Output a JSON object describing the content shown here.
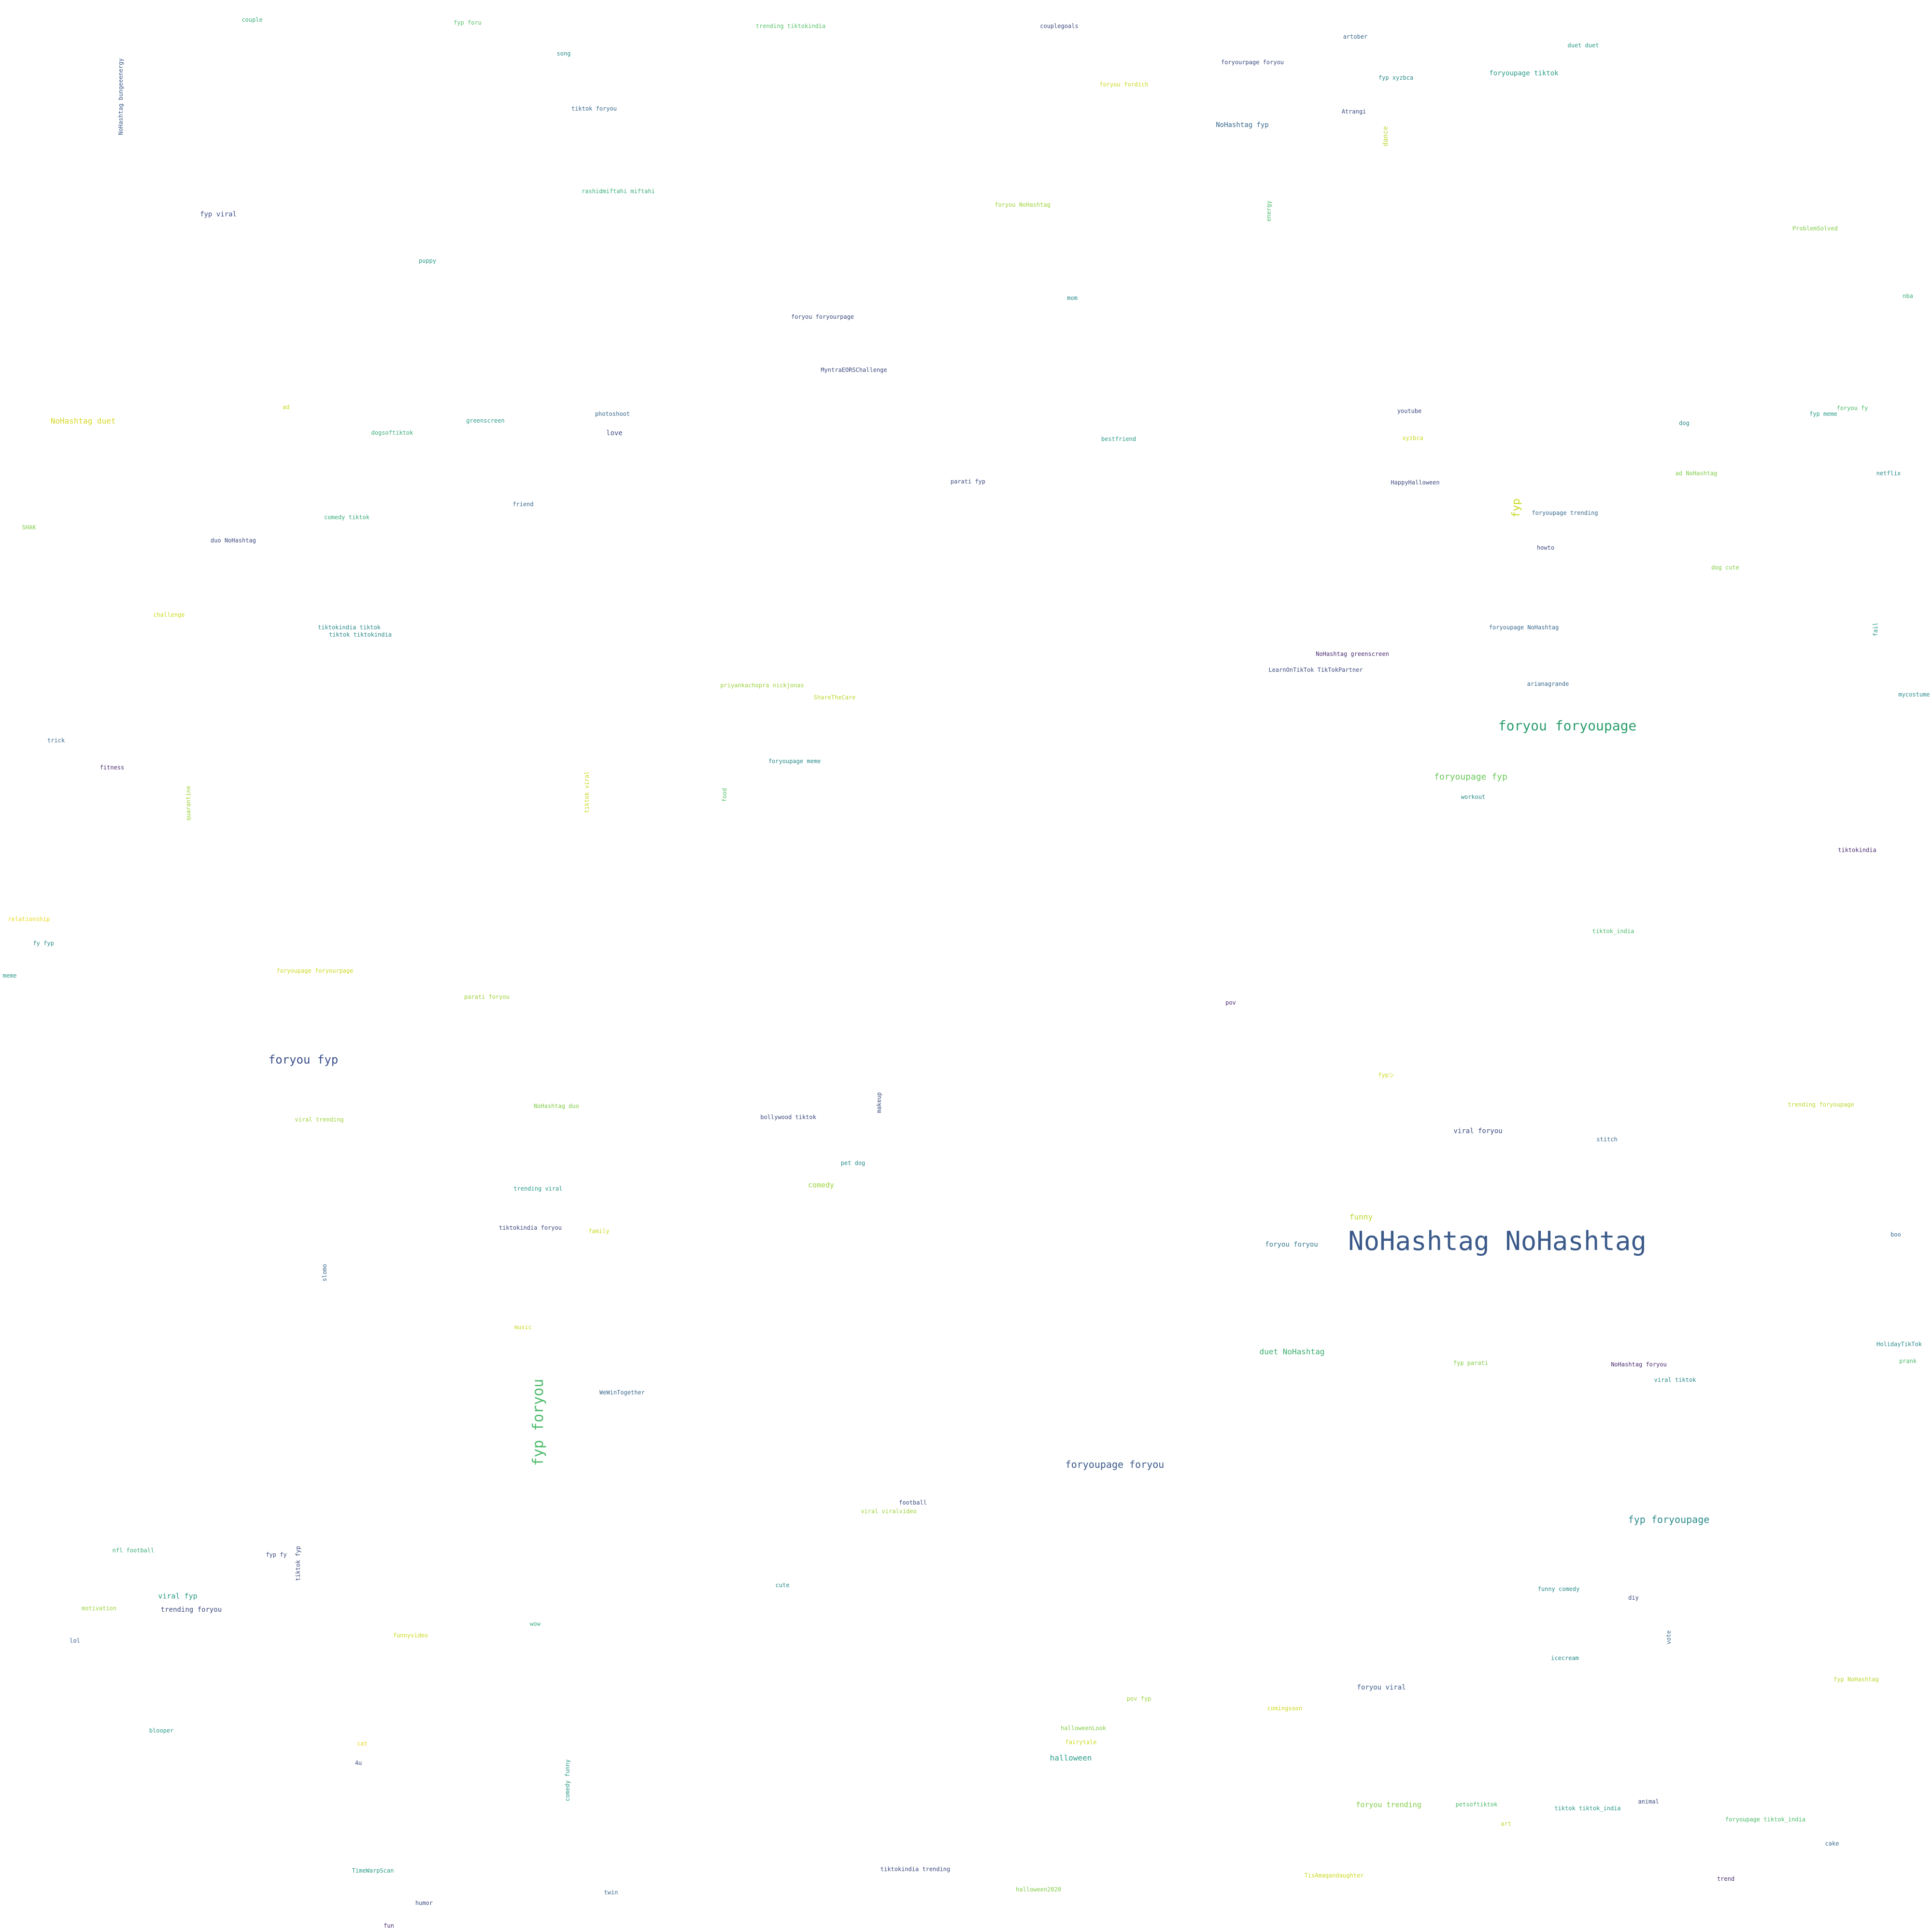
{
  "words": [
    {
      "text": "NoHashtag NoHashtag",
      "color": "#3b5a8a"
    },
    {
      "text": "foryou foryoupage",
      "color": "#2a9d6e"
    },
    {
      "text": "fyp foryou",
      "color": "#4cba6a"
    },
    {
      "text": "foryou fyp",
      "color": "#3b4f8a"
    },
    {
      "text": "foryoupage foryou",
      "color": "#3b5a8a"
    },
    {
      "text": "fyp foryoupage",
      "color": "#2b8a8a"
    },
    {
      "text": "duet NoHashtag",
      "color": "#3aad6e"
    },
    {
      "text": "foryoupage fyp",
      "color": "#6ac85a"
    },
    {
      "text": "NoHashtag duet",
      "color": "#d8d828"
    },
    {
      "text": "fyp",
      "color": "#cad820"
    },
    {
      "text": "funny",
      "color": "#b8d830"
    },
    {
      "text": "halloween",
      "color": "#2b9c8a"
    },
    {
      "text": "foryou trending",
      "color": "#82cc48"
    },
    {
      "text": "viral foryou",
      "color": "#3b4a7e"
    },
    {
      "text": "comedy",
      "color": "#9cd23a"
    },
    {
      "text": "viral fyp",
      "color": "#2b9a82"
    },
    {
      "text": "trending foryou",
      "color": "#3b4a7e"
    },
    {
      "text": "foryou viral",
      "color": "#3b5a8a"
    },
    {
      "text": "foryou foryou",
      "color": "#3a7a8e"
    },
    {
      "text": "fyp viral",
      "color": "#3b4f8a"
    },
    {
      "text": "NoHashtag fyp",
      "color": "#3a6a8e"
    },
    {
      "text": "foryoupage tiktok",
      "color": "#2b9a88"
    },
    {
      "text": "love",
      "color": "#3b4a7e"
    },
    {
      "text": "couple",
      "color": "#3aad7a"
    },
    {
      "text": "fyp foru",
      "color": "#5ac26a"
    },
    {
      "text": "trending tiktokindia",
      "color": "#5ac26a"
    },
    {
      "text": "couplegoals",
      "color": "#3b4a7e"
    },
    {
      "text": "artober",
      "color": "#3a6a8e"
    },
    {
      "text": "duet duet",
      "color": "#2b9a88"
    },
    {
      "text": "foryourpage foryou",
      "color": "#3b4a7e"
    },
    {
      "text": "fyp xyzbca",
      "color": "#2b8a8a"
    },
    {
      "text": "foryou fordich",
      "color": "#cad820"
    },
    {
      "text": "song",
      "color": "#2b8a8a"
    },
    {
      "text": "tiktok foryou",
      "color": "#3a6a8e"
    },
    {
      "text": "Atrangi",
      "color": "#3b4a7e"
    },
    {
      "text": "dance",
      "color": "#b8d830"
    },
    {
      "text": "NoHashtag bungeeenergy",
      "color": "#3b5a8a"
    },
    {
      "text": "rashidmiftahi miftahi",
      "color": "#3aad7a"
    },
    {
      "text": "foryou NoHashtag",
      "color": "#9cd23a"
    },
    {
      "text": "energy",
      "color": "#4cba6a"
    },
    {
      "text": "ProblemSolved",
      "color": "#82cc48"
    },
    {
      "text": "puppy",
      "color": "#2b9a88"
    },
    {
      "text": "mom",
      "color": "#2b8a8a"
    },
    {
      "text": "nba",
      "color": "#3aad7a"
    },
    {
      "text": "foryou foryourpage",
      "color": "#3b4a7e"
    },
    {
      "text": "MyntraEORSChallenge",
      "color": "#3b4a7e"
    },
    {
      "text": "ad",
      "color": "#cad820"
    },
    {
      "text": "greenscreen",
      "color": "#2b9a88"
    },
    {
      "text": "photoshoot",
      "color": "#3a6a8e"
    },
    {
      "text": "dogsoftiktok",
      "color": "#3aad7a"
    },
    {
      "text": "youtube",
      "color": "#3b4a7e"
    },
    {
      "text": "dog",
      "color": "#2b8a8a"
    },
    {
      "text": "fyp meme",
      "color": "#2b9a88"
    },
    {
      "text": "foryou fy",
      "color": "#4cba6a"
    },
    {
      "text": "bestfriend",
      "color": "#2b9a88"
    },
    {
      "text": "xyzbca",
      "color": "#cad820"
    },
    {
      "text": "ad NoHashtag",
      "color": "#82cc48"
    },
    {
      "text": "netflix",
      "color": "#2b8a8a"
    },
    {
      "text": "parati fyp",
      "color": "#3b4a7e"
    },
    {
      "text": "HappyHalloween",
      "color": "#3b4a7e"
    },
    {
      "text": "foryoupage trending",
      "color": "#3a6a8e"
    },
    {
      "text": "friend",
      "color": "#3a6a8e"
    },
    {
      "text": "comedy tiktok",
      "color": "#3aad7a"
    },
    {
      "text": "SHAK",
      "color": "#82cc48"
    },
    {
      "text": "duo NoHashtag",
      "color": "#3b4a7e"
    },
    {
      "text": "howto",
      "color": "#3b4a7e"
    },
    {
      "text": "dog cute",
      "color": "#82cc48"
    },
    {
      "text": "challenge",
      "color": "#cad820"
    },
    {
      "text": "tiktokindia tiktok",
      "color": "#2b8a8a"
    },
    {
      "text": "tiktok tiktokindia",
      "color": "#2b8a8a"
    },
    {
      "text": "foryoupage NoHashtag",
      "color": "#3a6a8e"
    },
    {
      "text": "fail",
      "color": "#2b9a88"
    },
    {
      "text": "NoHashtag greenscreen",
      "color": "#4a2a6e"
    },
    {
      "text": "LearnOnTikTok TikTokPartner",
      "color": "#3b4a7e"
    },
    {
      "text": "arianagrande",
      "color": "#3a6a8e"
    },
    {
      "text": "mycostume",
      "color": "#2b8a8a"
    },
    {
      "text": "priyankachopra nickjonas",
      "color": "#9cd23a"
    },
    {
      "text": "ShareTheCare",
      "color": "#b8d830"
    },
    {
      "text": "trick",
      "color": "#3a6a8e"
    },
    {
      "text": "fitness",
      "color": "#4a2a6e"
    },
    {
      "text": "quarantine",
      "color": "#9cd23a"
    },
    {
      "text": "tiktok viral",
      "color": "#cad820"
    },
    {
      "text": "foryoupage meme",
      "color": "#2b8a8a"
    },
    {
      "text": "food",
      "color": "#5ac26a"
    },
    {
      "text": "workout",
      "color": "#2b8a8a"
    },
    {
      "text": "tiktokindia",
      "color": "#4a2a6e"
    },
    {
      "text": "relationship",
      "color": "#e8d820"
    },
    {
      "text": "fy fyp",
      "color": "#2b8a8a"
    },
    {
      "text": "meme",
      "color": "#2b9a88"
    },
    {
      "text": "foryoupage foryourpage",
      "color": "#cad820"
    },
    {
      "text": "parati foryou",
      "color": "#9cd23a"
    },
    {
      "text": "tiktok_india",
      "color": "#4cba6a"
    },
    {
      "text": "pov",
      "color": "#4a2a6e"
    },
    {
      "text": "fypシ",
      "color": "#cad820"
    },
    {
      "text": "trending foryoupage",
      "color": "#b8d830"
    },
    {
      "text": "viral trending",
      "color": "#9cd23a"
    },
    {
      "text": "NoHashtag duo",
      "color": "#82cc48"
    },
    {
      "text": "bollywood tiktok",
      "color": "#3b4a7e"
    },
    {
      "text": "makeup",
      "color": "#3b4a7e"
    },
    {
      "text": "stitch",
      "color": "#3a6a8e"
    },
    {
      "text": "pet dog",
      "color": "#2b8a8a"
    },
    {
      "text": "trending viral",
      "color": "#2b9a88"
    },
    {
      "text": "tiktokindia foryou",
      "color": "#3b4a7e"
    },
    {
      "text": "family",
      "color": "#cad820"
    },
    {
      "text": "boo",
      "color": "#3a6a8e"
    },
    {
      "text": "slomo",
      "color": "#3a6a8e"
    },
    {
      "text": "music",
      "color": "#cad820"
    },
    {
      "text": "HolidayTikTok",
      "color": "#2b8a8a"
    },
    {
      "text": "fyp parati",
      "color": "#82cc48"
    },
    {
      "text": "NoHashtag foryou",
      "color": "#4a2a6e"
    },
    {
      "text": "prank",
      "color": "#4cba6a"
    },
    {
      "text": "viral tiktok",
      "color": "#2b8a8a"
    },
    {
      "text": "WeWinTogether",
      "color": "#3a6a8e"
    },
    {
      "text": "football",
      "color": "#3b4a7e"
    },
    {
      "text": "viral viralvideo",
      "color": "#9cd23a"
    },
    {
      "text": "nfl football",
      "color": "#3aad7a"
    },
    {
      "text": "fyp fy",
      "color": "#3b4a7e"
    },
    {
      "text": "tiktok fyp",
      "color": "#3b4a7e"
    },
    {
      "text": "cute",
      "color": "#2b8a8a"
    },
    {
      "text": "funny comedy",
      "color": "#2b8a8a"
    },
    {
      "text": "diy",
      "color": "#3b4a7e"
    },
    {
      "text": "motivation",
      "color": "#9cd23a"
    },
    {
      "text": "lol",
      "color": "#3b5a8a"
    },
    {
      "text": "funnyvideo",
      "color": "#cad820"
    },
    {
      "text": "wow",
      "color": "#3aad7a"
    },
    {
      "text": "vote",
      "color": "#3a6a8e"
    },
    {
      "text": "icecream",
      "color": "#2b8a8a"
    },
    {
      "text": "fyp NoHashtag",
      "color": "#b8d830"
    },
    {
      "text": "pov fyp",
      "color": "#9cd23a"
    },
    {
      "text": "comingsoon",
      "color": "#cad820"
    },
    {
      "text": "blooper",
      "color": "#2b9a88"
    },
    {
      "text": "halloweenLook",
      "color": "#82cc48"
    },
    {
      "text": "cat",
      "color": "#e8d820"
    },
    {
      "text": "fairytale",
      "color": "#cad820"
    },
    {
      "text": "4u",
      "color": "#3b4a7e"
    },
    {
      "text": "comedy funny",
      "color": "#2b9a88"
    },
    {
      "text": "petsoftiktok",
      "color": "#4cba6a"
    },
    {
      "text": "tiktok tiktok_india",
      "color": "#2b9a88"
    },
    {
      "text": "animal",
      "color": "#3b4a7e"
    },
    {
      "text": "art",
      "color": "#b8d830"
    },
    {
      "text": "foryoupage tiktok_india",
      "color": "#4cba6a"
    },
    {
      "text": "cake",
      "color": "#3a6a8e"
    },
    {
      "text": "TimeWarpScan",
      "color": "#2b9a88"
    },
    {
      "text": "tiktokindia trending",
      "color": "#3b4a7e"
    },
    {
      "text": "TisAmagandaughter",
      "color": "#cad820"
    },
    {
      "text": "trend",
      "color": "#4a2a6e"
    },
    {
      "text": "humor",
      "color": "#3b4a7e"
    },
    {
      "text": "twin",
      "color": "#3a6a8e"
    },
    {
      "text": "halloween2020",
      "color": "#82cc48"
    },
    {
      "text": "fun",
      "color": "#4a2a6e"
    }
  ]
}
